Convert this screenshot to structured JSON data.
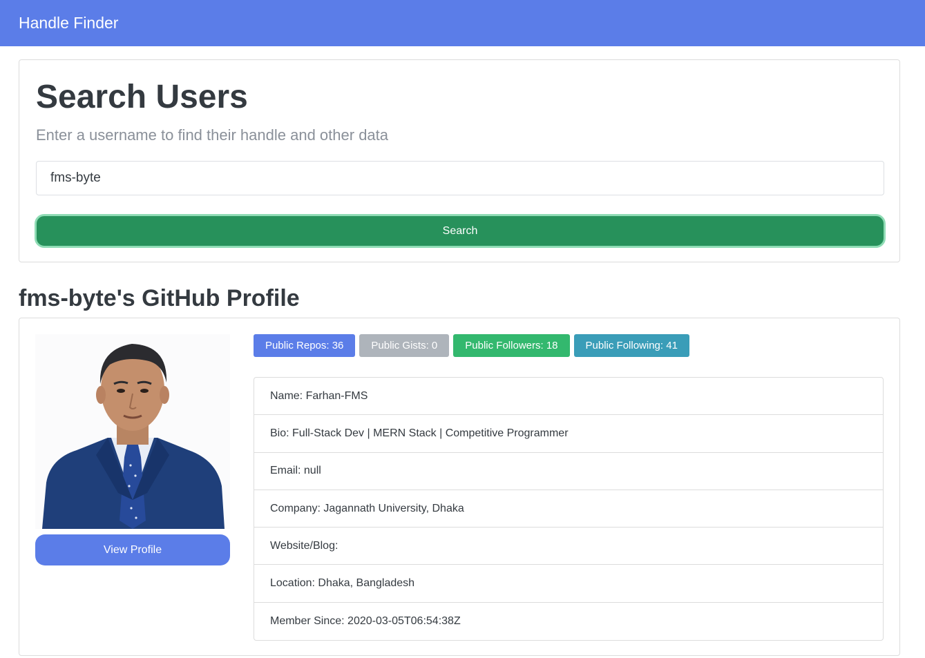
{
  "navbar": {
    "brand": "Handle Finder",
    "color": "#5b7de8"
  },
  "search": {
    "title": "Search Users",
    "subtitle": "Enter a username to find their handle and other data",
    "input_value": "fms-byte",
    "button_label": "Search",
    "button_color": "#27915b"
  },
  "profile": {
    "heading": "fms-byte's GitHub Profile",
    "view_profile_label": "View Profile",
    "badges": {
      "repos": "Public Repos: 36",
      "gists": "Public Gists: 0",
      "followers": "Public Followers: 18",
      "following": "Public Following: 41"
    },
    "details": [
      "Name: Farhan-FMS",
      "Bio: Full-Stack Dev | MERN Stack | Competitive Programmer",
      "Email: null",
      "Company: Jagannath University, Dhaka",
      "Website/Blog:",
      "Location: Dhaka, Bangladesh",
      "Member Since: 2020-03-05T06:54:38Z"
    ]
  }
}
